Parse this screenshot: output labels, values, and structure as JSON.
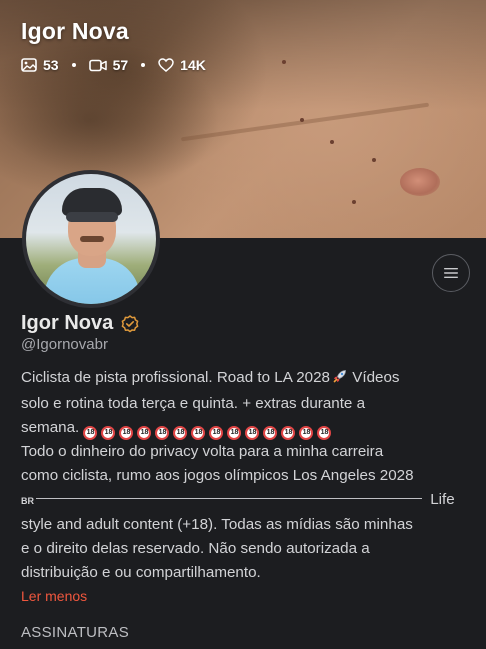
{
  "header": {
    "title": "Igor Nova",
    "stats": {
      "photos": "53",
      "videos": "57",
      "likes": "14K"
    },
    "icons": [
      "image-icon",
      "video-icon",
      "heart-icon"
    ]
  },
  "profile": {
    "name": "Igor Nova",
    "handle": "@Igornovabr",
    "verified_icon": "verified-badge-icon",
    "menu_icon": "hamburger-menu-icon"
  },
  "bio": {
    "line1": "Ciclista de pista profissional. Road to LA 2028",
    "line1_after": " Vídeos",
    "line2": "solo e rotina toda terça e quinta. + extras durante a",
    "line3_prefix": "semana. ",
    "emoji_18_label": "18",
    "emoji_18_count": 14,
    "line4": "Todo o dinheiro do privacy volta para a minha carreira",
    "line5": "como ciclista, rumo aos jogos olímpicos Los Angeles 2028",
    "flag": "BR",
    "line6_suffix": " Life",
    "line7": "style and adult content (+18). Todas as mídias são minhas",
    "line8": "e o direito delas reservado. Não sendo autorizada a",
    "line9": "distribuição e ou compartilhamento."
  },
  "actions": {
    "read_less": "Ler menos"
  },
  "sections": {
    "subscriptions_title": "ASSINATURAS"
  },
  "colors": {
    "background": "#1c1d20",
    "accent": "#f0573e",
    "verified": "#e09a3c",
    "text": "#d2d3d6"
  }
}
